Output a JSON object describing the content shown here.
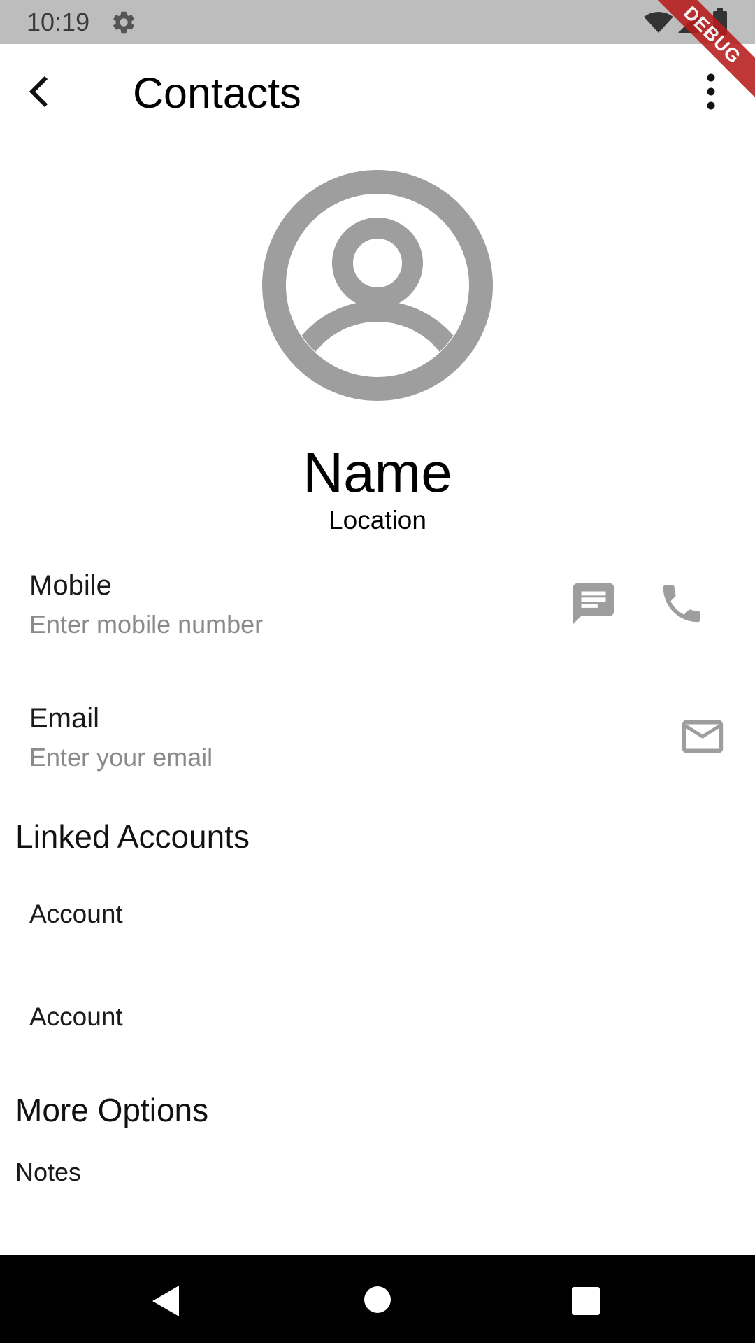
{
  "status_bar": {
    "time": "10:19",
    "icons": [
      "gear-icon",
      "wifi-icon",
      "signal-icon",
      "battery-icon"
    ]
  },
  "debug_banner": "DEBUG",
  "app_bar": {
    "title": "Contacts",
    "back_icon": "back-arrow-icon",
    "menu_icon": "more-vert-icon"
  },
  "contact": {
    "avatar_icon": "account-circle-icon",
    "name": "Name",
    "location": "Location"
  },
  "mobile": {
    "label": "Mobile",
    "placeholder": "Enter mobile number",
    "value": "",
    "actions": [
      "message-icon",
      "phone-icon"
    ]
  },
  "email": {
    "label": "Email",
    "placeholder": "Enter your email",
    "value": "",
    "actions": [
      "mail-icon"
    ]
  },
  "linked_accounts": {
    "title": "Linked Accounts",
    "items": [
      {
        "label": "Account"
      },
      {
        "label": "Account"
      }
    ]
  },
  "more_options": {
    "title": "More Options",
    "items": [
      {
        "label": "Notes"
      }
    ]
  },
  "colors": {
    "status_bar": "#bdbdbd",
    "icon_grey": "#9e9e9e",
    "debug_ribbon": "#b71c1c",
    "nav_bar": "#000000"
  }
}
